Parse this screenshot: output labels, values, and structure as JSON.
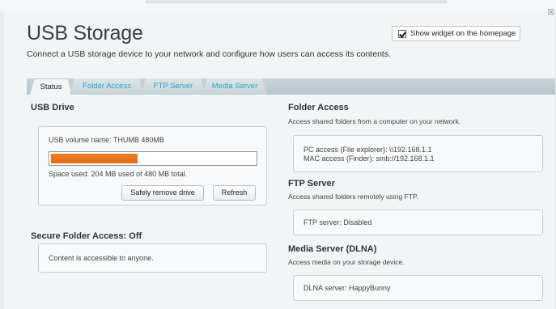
{
  "page": {
    "title": "USB Storage",
    "subtitle": "Connect a USB storage device to your network and configure how users can access its contents."
  },
  "widget": {
    "label": "Show widget on the homepage",
    "checked": true
  },
  "tabs": [
    {
      "label": "Status",
      "active": true
    },
    {
      "label": "Folder Access",
      "active": false
    },
    {
      "label": "FTP Server",
      "active": false
    },
    {
      "label": "Media Server",
      "active": false
    }
  ],
  "usb_drive": {
    "heading": "USB Drive",
    "volume_name": "USB volume name: THUMB 480MB",
    "space_used": "Space used: 204 MB used of 480 MB total.",
    "used_fraction": 0.425,
    "remove_button": "Safely remove drive",
    "refresh_button": "Refresh"
  },
  "secure_folder": {
    "heading": "Secure Folder Access: Off",
    "text": "Content is accessible to anyone."
  },
  "folder_access": {
    "heading": "Folder Access",
    "subtitle": "Access shared folders from a computer on your network.",
    "pc_access": "PC access (File explorer): \\\\192.168.1.1",
    "mac_access": "MAC access (Finder): smb://192.168.1.1"
  },
  "ftp_server": {
    "heading": "FTP Server",
    "subtitle": "Access shared folders remotely using FTP.",
    "status": "FTP server: Disabled"
  },
  "media_server": {
    "heading": "Media Server (DLNA)",
    "subtitle": "Access media on your storage device.",
    "status": "DLNA server: HappyBunny"
  },
  "colors": {
    "accent": "#26a8c7",
    "progress": "#e8741a"
  }
}
